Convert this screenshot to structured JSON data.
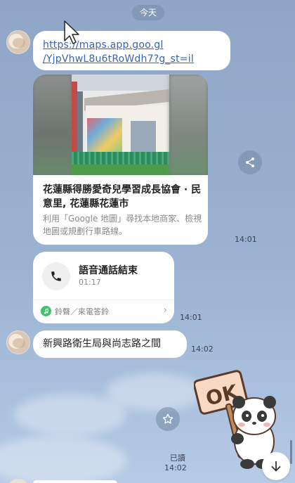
{
  "date_separator": "今天",
  "messages": {
    "link": {
      "text": "https://maps.app.goo.gl/YjpVhwL8u6tRoWdh7?g_st=il",
      "line1": "https://maps.app.goo.gl",
      "line2": "/YjpVhwL8u6tRoWdh7?g_st=il"
    },
    "map_card": {
      "title": "花蓮縣得勝愛奇兒學習成長協會 · 民意里, 花蓮縣花蓮市",
      "description": "利用「Google 地圖」尋找本地商家、檢視地圖或規劃行車路線。",
      "time": "14:01"
    },
    "call_card": {
      "title": "語音通話結束",
      "duration": "01:17",
      "ringtone_label": "鈴聲／來電答鈴",
      "time": "14:01"
    },
    "text_message": {
      "text": "新興路衛生局與尚志路之間",
      "time": "14:02"
    },
    "sticker": {
      "sign_text": "OK",
      "read_status": "已讀",
      "time": "14:02"
    }
  },
  "icons": {
    "share": "share-icon",
    "phone": "phone-icon",
    "ringtone": "music-note-icon",
    "favorite": "star-icon",
    "scroll_down": "arrow-down-icon"
  },
  "colors": {
    "link": "#3a63b5",
    "ringtone_green": "#3fc16a",
    "chat_background": "#9cb2d2"
  }
}
